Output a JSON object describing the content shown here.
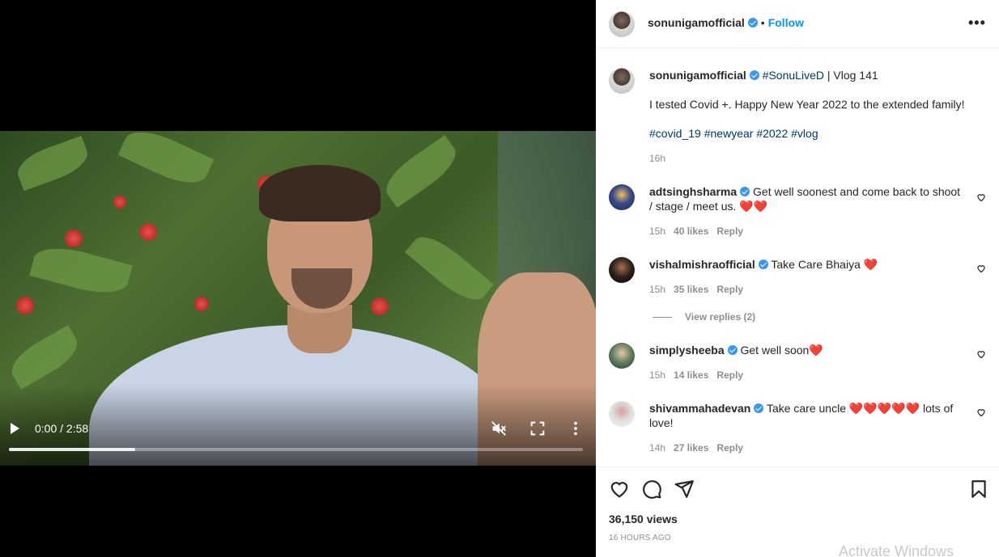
{
  "video": {
    "time_display": "0:00 / 2:58",
    "progress_fraction": 0.22,
    "mute_icon": "volume-muted-icon",
    "fullscreen_icon": "fullscreen-icon",
    "menu_icon": "more-vertical-icon"
  },
  "header": {
    "username": "sonunigamofficial",
    "separator": "•",
    "follow_label": "Follow",
    "more_label": "•••"
  },
  "caption": {
    "username": "sonunigamofficial",
    "hashtag_title": "#SonuLiveD",
    "title_rest": " | Vlog 141",
    "body": "I tested Covid +. Happy New Year 2022 to the extended family!",
    "tags": [
      "#covid_19",
      "#newyear",
      "#2022",
      "#vlog"
    ],
    "time": "16h"
  },
  "comments": [
    {
      "username": "adtsinghsharma",
      "text": "Get well soonest and come back to shoot / stage / meet us.",
      "emoji": "❤️❤️",
      "time": "15h",
      "likes": "40 likes",
      "reply": "Reply"
    },
    {
      "username": "vishalmishraofficial",
      "text": "Take Care Bhaiya",
      "emoji": "❤️",
      "time": "15h",
      "likes": "35 likes",
      "reply": "Reply",
      "view_replies": "View replies (2)"
    },
    {
      "username": "simplysheeba",
      "text": "Get well soon",
      "emoji": "❤️",
      "time": "15h",
      "likes": "14 likes",
      "reply": "Reply"
    },
    {
      "username": "shivammahadevan",
      "text_before": "Take care uncle",
      "emoji": "❤️❤️❤️❤️❤️",
      "text_after": "lots of love!",
      "time": "14h",
      "likes": "27 likes",
      "reply": "Reply"
    }
  ],
  "footer": {
    "views": "36,150 views",
    "posted": "16 HOURS AGO",
    "watermark": "Activate Windows"
  },
  "colors": {
    "accent": "#0095f6",
    "verified": "#3897f0",
    "heart": "#ed4956",
    "hashtag": "#00376b",
    "muted": "#8e8e8e"
  }
}
